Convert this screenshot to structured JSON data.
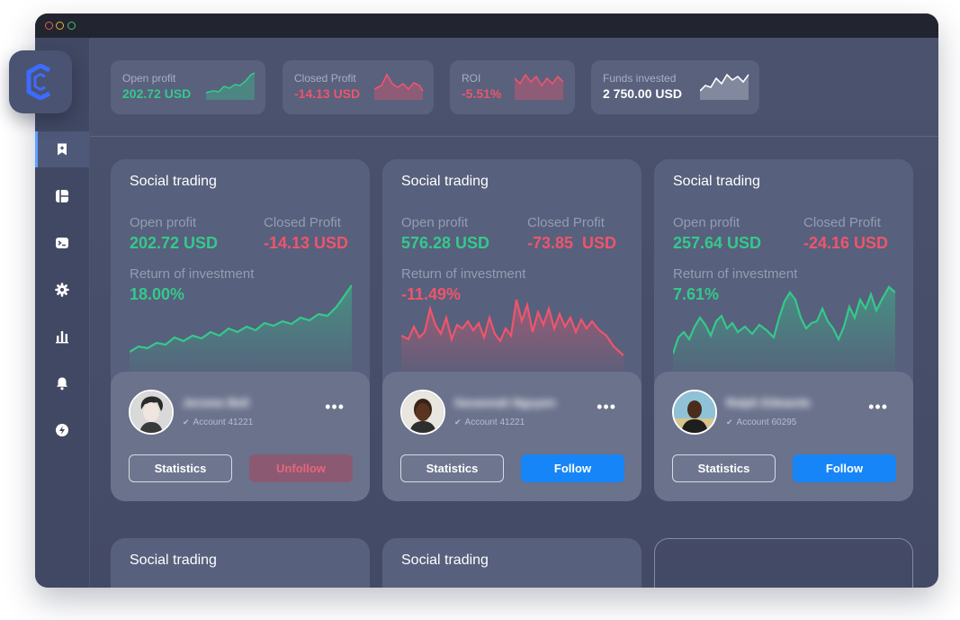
{
  "window": {
    "controls": [
      "close",
      "minimize",
      "maximize"
    ]
  },
  "logo": {
    "icon": "c-logo-icon",
    "color": "#3d6bff"
  },
  "sidebar": {
    "items": [
      {
        "icon": "bookmark-icon",
        "active": true
      },
      {
        "icon": "dashboard-icon",
        "active": false
      },
      {
        "icon": "terminal-icon",
        "active": false
      },
      {
        "icon": "gear-icon",
        "active": false
      },
      {
        "icon": "bar-chart-icon",
        "active": false
      },
      {
        "icon": "bell-icon",
        "active": false
      },
      {
        "icon": "lightning-icon",
        "active": false
      }
    ]
  },
  "top_stats": [
    {
      "label": "Open profit",
      "value": "202.72 USD",
      "color": "#34c98b"
    },
    {
      "label": "Closed Profit",
      "value": "-14.13 USD",
      "color": "#f0546c"
    },
    {
      "label": "ROI",
      "value": "-5.51%",
      "color": "#f0546c"
    },
    {
      "label": "Funds invested",
      "value": "2 750.00 USD",
      "color": "#ffffff"
    }
  ],
  "cards": [
    {
      "title": "Social trading",
      "open_label": "Open profit",
      "open_value": "202.72 USD",
      "closed_label": "Closed Profit",
      "closed_value": "-14.13 USD",
      "roi_label": "Return of investment",
      "roi_value": "18.00%",
      "trend": "up",
      "name": "Jerome Bell",
      "account": "Account 41221",
      "stats_label": "Statistics",
      "action_label": "Unfollow"
    },
    {
      "title": "Social trading",
      "open_label": "Open profit",
      "open_value": "576.28 USD",
      "closed_label": "Closed Profit",
      "closed_value": "-73.85  USD",
      "roi_label": "Return of investment",
      "roi_value": "-11.49%",
      "trend": "down",
      "name": "Savannah Nguyen",
      "account": "Account 41221",
      "stats_label": "Statistics",
      "action_label": "Follow"
    },
    {
      "title": "Social trading",
      "open_label": "Open profit",
      "open_value": "257.64 USD",
      "closed_label": "Closed Profit",
      "closed_value": "-24.16 USD",
      "roi_label": "Return of investment",
      "roi_value": "7.61%",
      "trend": "up",
      "name": "Ralph Edwards",
      "account": "Account 60295",
      "stats_label": "Statistics",
      "action_label": "Follow"
    }
  ],
  "bottom_cards": [
    {
      "title": "Social trading"
    },
    {
      "title": "Social trading"
    }
  ],
  "colors": {
    "positive": "#34c98b",
    "negative": "#f0546c",
    "follow": "#1685f7",
    "background": "#4b536f"
  }
}
